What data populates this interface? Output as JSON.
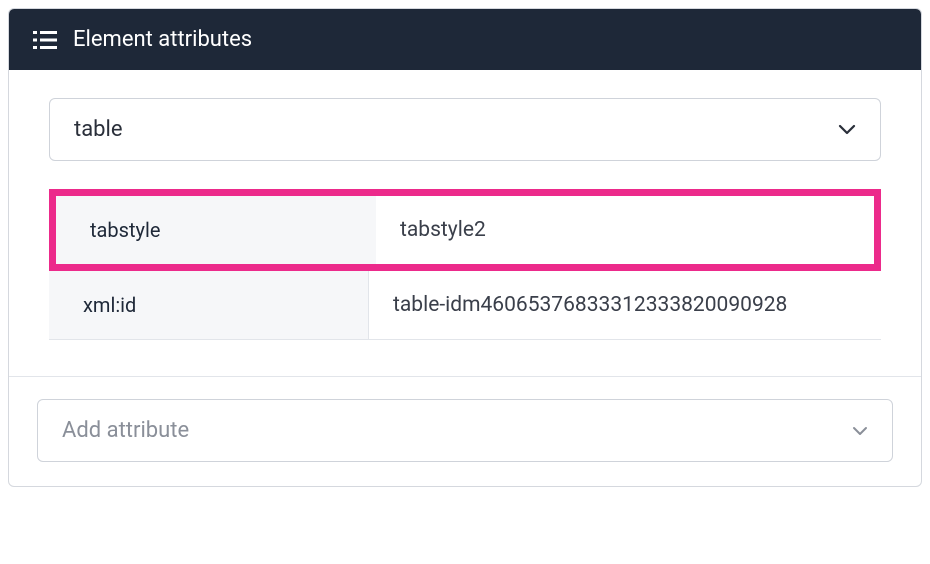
{
  "header": {
    "title": "Element attributes"
  },
  "element_select": {
    "value": "table"
  },
  "attributes": [
    {
      "key": "tabstyle",
      "value": "tabstyle2",
      "highlighted": true
    },
    {
      "key": "xml:id",
      "value": "table-idm46065376833312333820090928",
      "highlighted": false
    }
  ],
  "add_attribute": {
    "placeholder": "Add attribute"
  }
}
